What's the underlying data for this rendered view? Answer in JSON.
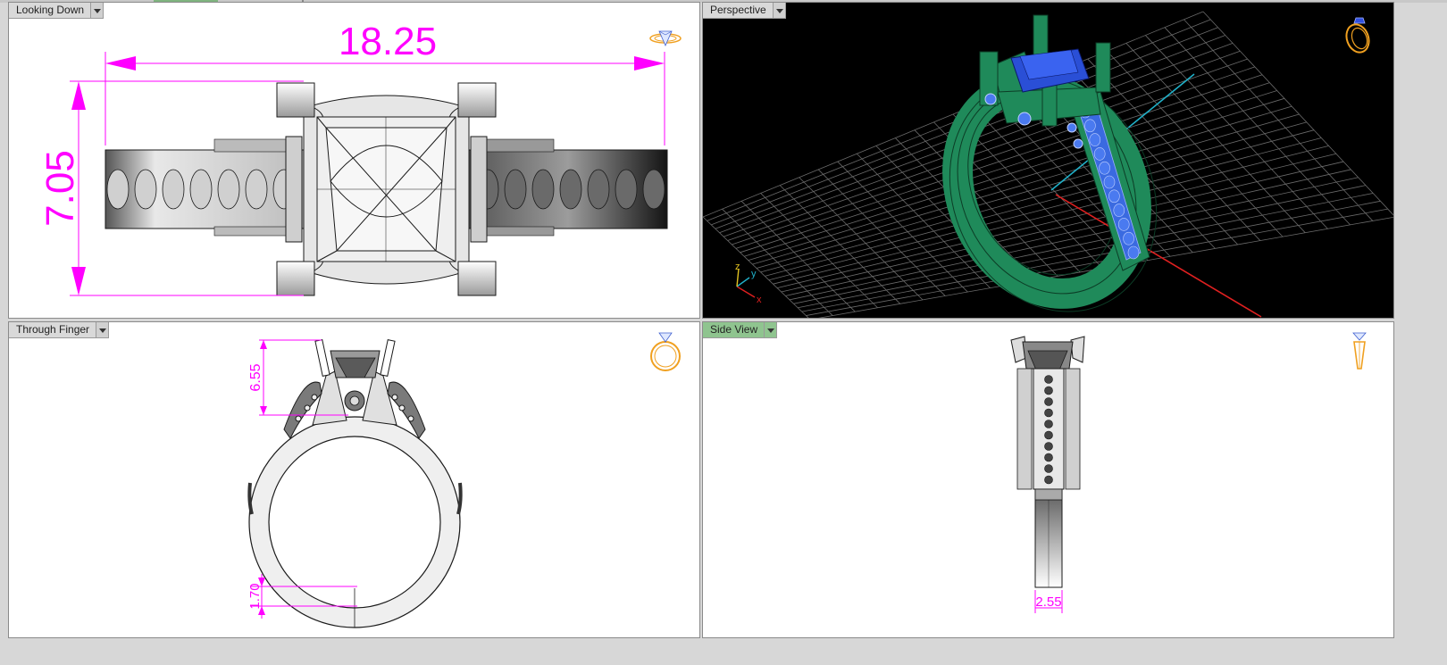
{
  "colors": {
    "dimension": "#ff00ff",
    "model_face": "#f2f2f2",
    "model_edge": "#1a1a1a",
    "metal_green": "#1f8a5a",
    "gem_blue": "#2a4fd6",
    "grid": "#6a6a6a",
    "axis_x": "#e02020",
    "axis_y": "#20b0c8",
    "active_tab": "#8fc48f",
    "corner_icon": "#f0a020"
  },
  "viewports": {
    "top_left": {
      "title": "Looking Down",
      "dimensions": {
        "width": "18.25",
        "height": "7.05"
      }
    },
    "top_right": {
      "title": "Perspective",
      "axis_labels": {
        "x": "x",
        "y": "y",
        "z": "z"
      }
    },
    "bottom_left": {
      "title": "Through Finger",
      "dimensions": {
        "head_height": "6.55",
        "shank_thickness": "1.70"
      }
    },
    "bottom_right": {
      "title": "Side View",
      "active": true,
      "dimensions": {
        "shank_width": "2.55"
      }
    }
  },
  "icons": {
    "top_left": "ring-top-icon",
    "top_right": "ring-perspective-icon",
    "bottom_left": "ring-front-icon",
    "bottom_right": "ring-side-icon"
  }
}
